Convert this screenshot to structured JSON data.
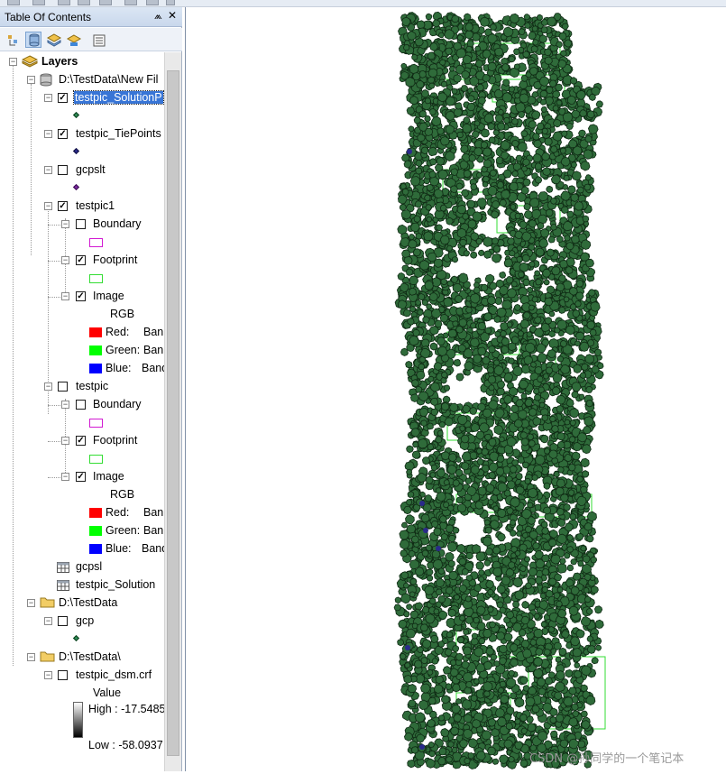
{
  "toc": {
    "title": "Table Of Contents",
    "pin_glyph": "⩕",
    "close_glyph": "✕",
    "tools": [
      "list-by-drawing-order-icon",
      "list-by-source-icon",
      "list-by-visibility-icon",
      "list-by-selection-icon",
      "options-icon"
    ],
    "tree": {
      "layers_label": "Layers",
      "source1_label": "D:\\TestData\\New Fil",
      "solution_points_label": "testpic_SolutionP",
      "tiepoints_label": "testpic_TiePoints",
      "gcpslt_label": "gcpslt",
      "testpic1_label": "testpic1",
      "testpic1_boundary": "Boundary",
      "testpic1_footprint": "Footprint",
      "testpic1_image": "Image",
      "testpic1_rgb": "RGB",
      "testpic1_red": "Red:",
      "testpic1_red_val": "Ban",
      "testpic1_green": "Green:",
      "testpic1_green_val": "Ban",
      "testpic1_blue": "Blue:",
      "testpic1_blue_val": "Band",
      "testpic_label": "testpic",
      "testpic_boundary": "Boundary",
      "testpic_footprint": "Footprint",
      "testpic_image": "Image",
      "testpic_rgb": "RGB",
      "testpic_red": "Red:",
      "testpic_red_val": "Ban",
      "testpic_green": "Green:",
      "testpic_green_val": "Ban",
      "testpic_blue": "Blue:",
      "testpic_blue_val": "Band",
      "gcpsl_label": "gcpsl",
      "testpic_solution_label": "testpic_Solution",
      "source2_label": "D:\\TestData",
      "gcp_label": "gcp",
      "source3_label": "D:\\TestData\\",
      "dsm_label": "testpic_dsm.crf",
      "dsm_value": "Value",
      "dsm_high": "High : -17.5485",
      "dsm_low": "Low : -58.0937"
    }
  },
  "map": {
    "watermark": "CSDN @孙同学的一个笔记本"
  },
  "colors": {
    "point_fill": "#2f6b3a",
    "point_outline": "#0f2a14",
    "footprint_green": "#33dd33",
    "boundary_magenta": "#d21ad2",
    "red": "#ff0000",
    "green": "#00ff00",
    "blue": "#0000ff",
    "selection": "#3875d6"
  }
}
